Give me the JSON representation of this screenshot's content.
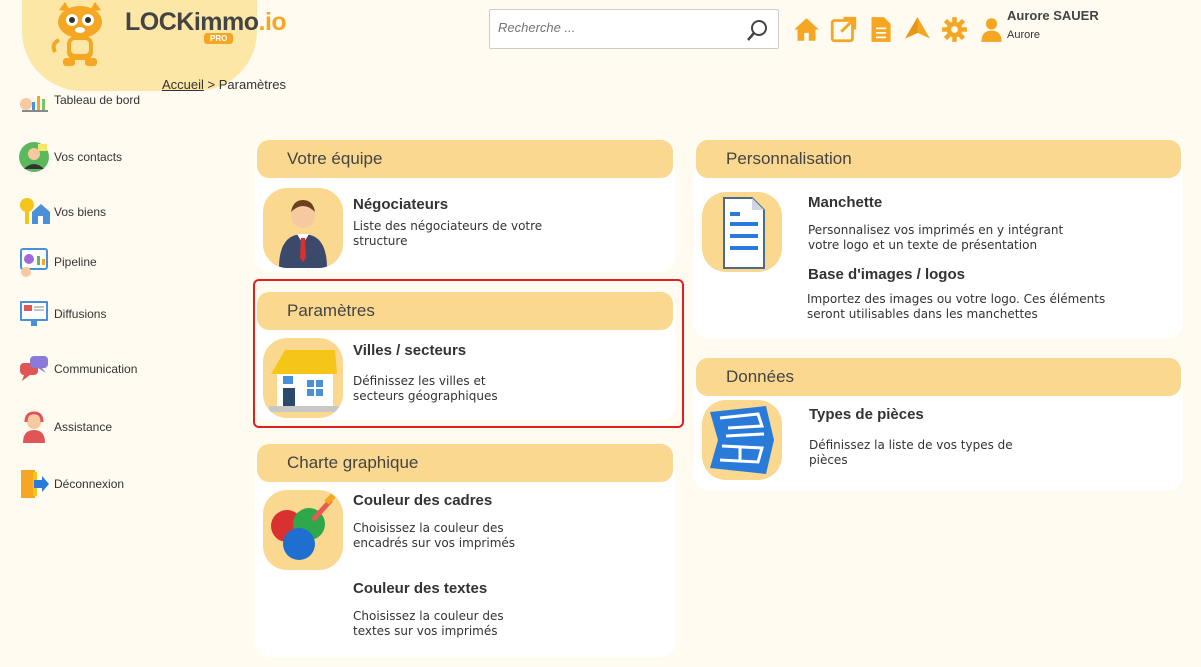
{
  "brand": {
    "name_main": "LOCKimmo",
    "name_suffix": ".io",
    "badge": "PRO"
  },
  "search": {
    "placeholder": "Recherche ..."
  },
  "topbar_icons": [
    "home-icon",
    "external-link-icon",
    "document-icon",
    "send-icon",
    "gear-icon",
    "user-icon"
  ],
  "user": {
    "name": "Aurore SAUER",
    "subtitle": "Aurore"
  },
  "sidebar": {
    "items": [
      {
        "label": "Tableau de bord",
        "icon": "dashboard-icon"
      },
      {
        "label": "Vos contacts",
        "icon": "contacts-icon"
      },
      {
        "label": "Vos biens",
        "icon": "properties-icon"
      },
      {
        "label": "Pipeline",
        "icon": "pipeline-icon"
      },
      {
        "label": "Diffusions",
        "icon": "diffusion-icon"
      },
      {
        "label": "Communication",
        "icon": "chat-icon"
      },
      {
        "label": "Assistance",
        "icon": "support-icon"
      },
      {
        "label": "Déconnexion",
        "icon": "logout-icon"
      }
    ]
  },
  "breadcrumb": {
    "home": "Accueil",
    "sep": ">",
    "current": "Paramètres"
  },
  "sections": {
    "equipe": {
      "title": "Votre équipe",
      "items": [
        {
          "title": "Négociateurs",
          "desc": "Liste des négociateurs de votre structure"
        }
      ]
    },
    "parametres": {
      "title": "Paramètres",
      "items": [
        {
          "title": "Villes / secteurs",
          "desc": "Définissez les villes et secteurs géographiques"
        }
      ]
    },
    "charte": {
      "title": "Charte graphique",
      "items": [
        {
          "title": "Couleur des cadres",
          "desc": "Choisissez la couleur des encadrés sur vos imprimés"
        },
        {
          "title": "Couleur des textes",
          "desc": "Choisissez la couleur des textes sur vos imprimés"
        }
      ]
    },
    "perso": {
      "title": "Personnalisation",
      "items": [
        {
          "title": "Manchette",
          "desc": "Personnalisez vos imprimés en y intégrant votre logo et un texte de présentation"
        },
        {
          "title": "Base d'images / logos",
          "desc": "Importez des images ou votre logo. Ces éléments seront utilisables dans les manchettes"
        }
      ]
    },
    "donnees": {
      "title": "Données",
      "items": [
        {
          "title": "Types de pièces",
          "desc": "Définissez la liste de vos types de pièces"
        }
      ]
    }
  },
  "colors": {
    "accent": "#f5a623",
    "header_bg": "#fbd88f",
    "page_bg": "#fffbf1",
    "selection": "#e02020"
  }
}
